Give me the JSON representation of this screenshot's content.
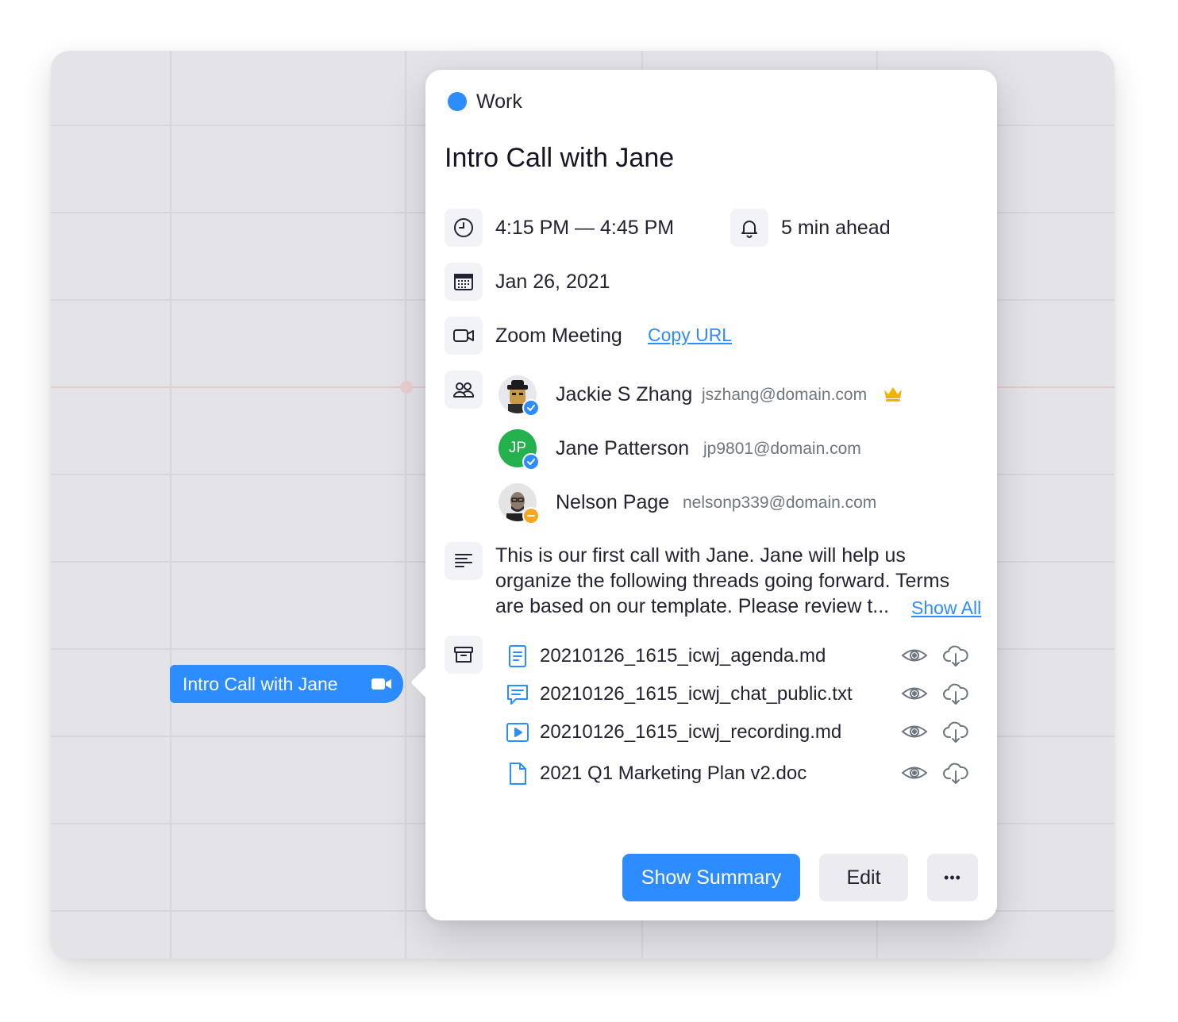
{
  "event_chip": {
    "label": "Intro Call with Jane",
    "icon": "video-icon"
  },
  "popover": {
    "calendar": {
      "name": "Work",
      "color": "#2d8cff"
    },
    "title": "Intro Call with Jane",
    "time": {
      "range": "4:15 PM — 4:45 PM",
      "icon": "clock-icon"
    },
    "reminder": {
      "text": "5 min ahead",
      "icon": "bell-icon"
    },
    "date": {
      "text": "Jan 26, 2021",
      "icon": "calendar-icon"
    },
    "meeting": {
      "text": "Zoom Meeting",
      "copy_label": "Copy URL",
      "icon": "video-icon"
    },
    "attendees": [
      {
        "name": "Jackie S Zhang",
        "email": "jszhang@domain.com",
        "status": "accepted",
        "host": true
      },
      {
        "name": "Jane Patterson",
        "email": "jp9801@domain.com",
        "initials": "JP",
        "status": "accepted",
        "avatar_color": "#22b14c"
      },
      {
        "name": "Nelson Page",
        "email": "nelsonp339@domain.com",
        "status": "tentative"
      }
    ],
    "description": "This is our first call with Jane. Jane will help us organize the following threads going forward. Terms are based on our template. Please review t...",
    "show_all_label": "Show All",
    "files": [
      {
        "name": "20210126_1615_icwj_agenda.md",
        "icon": "document-icon"
      },
      {
        "name": "20210126_1615_icwj_chat_public.txt",
        "icon": "chat-icon"
      },
      {
        "name": "20210126_1615_icwj_recording.md",
        "icon": "play-icon"
      },
      {
        "name": "2021 Q1 Marketing Plan v2.doc",
        "icon": "file-icon"
      }
    ],
    "buttons": {
      "summary": "Show Summary",
      "edit": "Edit",
      "more": "•••"
    }
  },
  "colors": {
    "accent": "#2d8cff",
    "background": "#e3e3e8",
    "crown": "#f0b400"
  }
}
